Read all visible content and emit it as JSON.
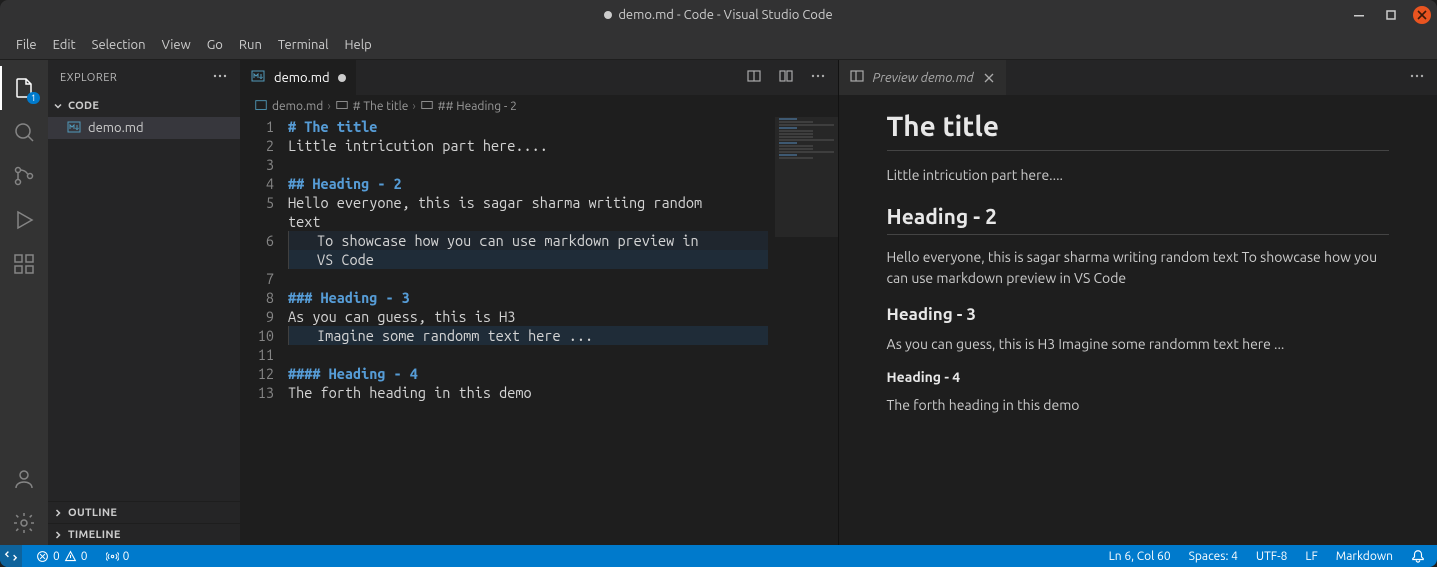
{
  "window": {
    "title": "demo.md - Code - Visual Studio Code",
    "dirty": true
  },
  "menubar": [
    "File",
    "Edit",
    "Selection",
    "View",
    "Go",
    "Run",
    "Terminal",
    "Help"
  ],
  "activitybar": {
    "explorer_badge": "1"
  },
  "sidebar": {
    "title": "EXPLORER",
    "workspace": "CODE",
    "files": [
      {
        "name": "demo.md",
        "active": true
      }
    ],
    "outline_label": "OUTLINE",
    "timeline_label": "TIMELINE"
  },
  "editor": {
    "tab": {
      "filename": "demo.md",
      "dirty": true
    },
    "breadcrumbs": {
      "file": "demo.md",
      "h1": "# The title",
      "h2": "## Heading - 2"
    },
    "lines": [
      {
        "n": 1,
        "type": "h",
        "text": "# The title"
      },
      {
        "n": 2,
        "type": "t",
        "text": "Little intricution part here...."
      },
      {
        "n": 3,
        "type": "t",
        "text": ""
      },
      {
        "n": 4,
        "type": "h",
        "text": "## Heading - 2"
      },
      {
        "n": 5,
        "type": "t",
        "text": "Hello everyone, this is sagar sharma writing random "
      },
      {
        "n": null,
        "type": "wrap",
        "text": "text"
      },
      {
        "n": 6,
        "type": "indent",
        "text": "To showcase how you can use markdown preview in "
      },
      {
        "n": null,
        "type": "indent-wrap",
        "text": "VS Code"
      },
      {
        "n": 7,
        "type": "t",
        "text": ""
      },
      {
        "n": 8,
        "type": "h",
        "text": "### Heading - 3"
      },
      {
        "n": 9,
        "type": "t",
        "text": "As you can guess, this is H3"
      },
      {
        "n": 10,
        "type": "indent",
        "text": "Imagine some randomm text here ..."
      },
      {
        "n": 11,
        "type": "t",
        "text": ""
      },
      {
        "n": 12,
        "type": "h",
        "text": "#### Heading - 4"
      },
      {
        "n": 13,
        "type": "t",
        "text": "The forth heading in this demo"
      }
    ]
  },
  "preview": {
    "tab_label": "Preview demo.md",
    "h1": "The title",
    "p1": "Little intricution part here....",
    "h2": "Heading - 2",
    "p2": "Hello everyone, this is sagar sharma writing random text To showcase how you can use markdown preview in VS Code",
    "h3": "Heading - 3",
    "p3": "As you can guess, this is H3 Imagine some randomm text here ...",
    "h4": "Heading - 4",
    "p4": "The forth heading in this demo"
  },
  "statusbar": {
    "errors": "0",
    "warnings": "0",
    "ports": "0",
    "cursor": "Ln 6, Col 60",
    "spaces": "Spaces: 4",
    "encoding": "UTF-8",
    "eol": "LF",
    "language": "Markdown"
  }
}
